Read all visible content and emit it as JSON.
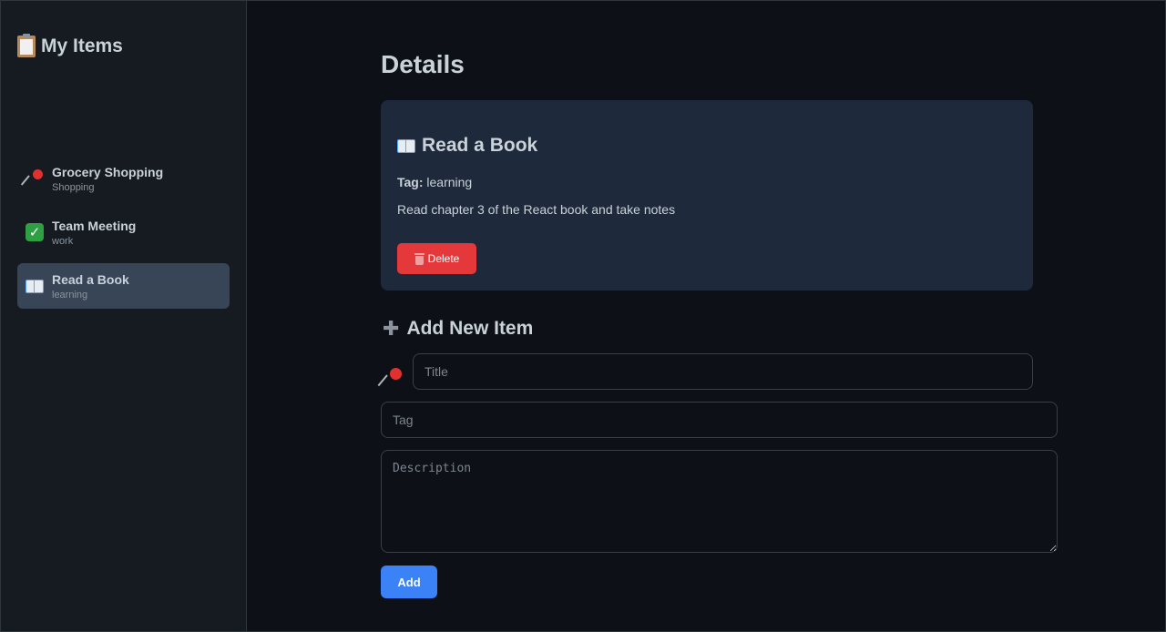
{
  "sidebar": {
    "title": "My Items",
    "items": [
      {
        "title": "Grocery Shopping",
        "tag": "Shopping",
        "icon": "pushpin-icon"
      },
      {
        "title": "Team Meeting",
        "tag": "work",
        "icon": "check-icon"
      },
      {
        "title": "Read a Book",
        "tag": "learning",
        "icon": "book-icon",
        "active": true
      }
    ]
  },
  "main": {
    "page_title": "Details",
    "detail": {
      "title": "Read a Book",
      "tag_label": "Tag:",
      "tag_value": "learning",
      "description": "Read chapter 3 of the React book and take notes",
      "delete_label": "Delete"
    },
    "add_form": {
      "heading": "Add New Item",
      "title_placeholder": "Title",
      "tag_placeholder": "Tag",
      "description_placeholder": "Description",
      "add_label": "Add"
    }
  },
  "colors": {
    "background": "#0d1117",
    "sidebar": "#161b22",
    "card": "#1e293b",
    "active_item": "#374556",
    "delete": "#e5383b",
    "primary": "#3b82f6"
  }
}
